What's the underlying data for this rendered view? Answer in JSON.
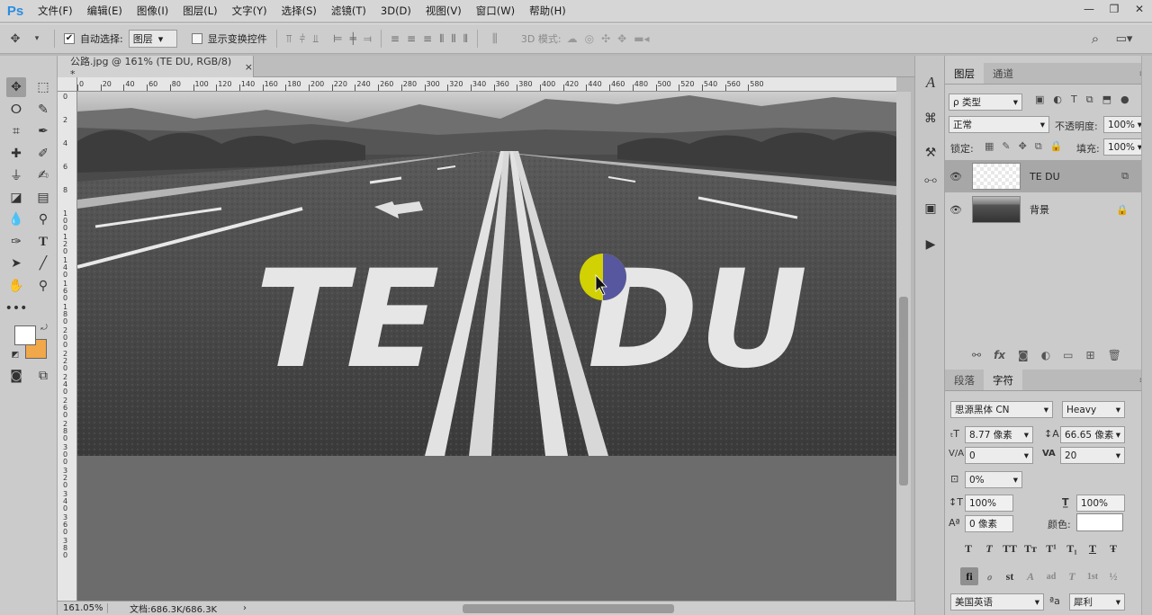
{
  "app": {
    "logo": "Ps"
  },
  "menubar": {
    "items": [
      "文件(F)",
      "编辑(E)",
      "图像(I)",
      "图层(L)",
      "文字(Y)",
      "选择(S)",
      "滤镜(T)",
      "3D(D)",
      "视图(V)",
      "窗口(W)",
      "帮助(H)"
    ]
  },
  "window_controls": {
    "minimize": "—",
    "restore": "❐",
    "close": "✕"
  },
  "options": {
    "auto_select_label": "自动选择:",
    "auto_select_checked": true,
    "auto_select_target": "图层",
    "show_transform_label": "显示变换控件",
    "show_transform_checked": false,
    "mode_3d_label": "3D 模式:"
  },
  "document": {
    "tab_title": "公路.jpg @ 161% (TE   DU, RGB/8) *",
    "tab_close": "×",
    "ruler_h": [
      "0",
      "20",
      "40",
      "60",
      "80",
      "100",
      "120",
      "140",
      "160",
      "180",
      "200",
      "220",
      "240",
      "260",
      "280",
      "300",
      "320",
      "340",
      "360",
      "380",
      "400",
      "420",
      "440",
      "460",
      "480",
      "500",
      "520",
      "540",
      "560",
      "580"
    ],
    "ruler_v": [
      "0",
      "2",
      "4",
      "6",
      "8",
      "1\n0\n0",
      "1\n2\n0",
      "1\n4\n0",
      "1\n6\n0",
      "1\n8\n0",
      "2\n0\n0",
      "2\n2\n0",
      "2\n4\n0",
      "2\n6\n0",
      "2\n8\n0",
      "3\n0\n0",
      "3\n2\n0",
      "3\n4\n0",
      "3\n6\n0",
      "3\n8\n0"
    ],
    "canvas_text_left": "TE",
    "canvas_text_right": "DU",
    "zoom": "161.05%",
    "doc_info": "文档:686.3K/686.3K",
    "status_arrow": "›"
  },
  "layers_panel": {
    "tabs": [
      "图层",
      "通道"
    ],
    "filter_label": "ρ 类型",
    "blend_mode": "正常",
    "opacity_label": "不透明度:",
    "opacity_value": "100%",
    "lock_label": "锁定:",
    "fill_label": "填充:",
    "fill_value": "100%",
    "layers": [
      {
        "name": "TE   DU",
        "visible": true,
        "selected": true
      },
      {
        "name": "背景",
        "visible": true,
        "selected": false
      }
    ]
  },
  "character_panel": {
    "tabs": [
      "段落",
      "字符"
    ],
    "font_family": "思源黑体 CN",
    "font_style": "Heavy",
    "font_size": "8.77 像素",
    "leading": "66.65 像素",
    "kerning": "0",
    "tracking": "20",
    "scale_pct": "0%",
    "vertical_scale": "100%",
    "horizontal_scale": "100%",
    "baseline_shift": "0 像素",
    "color_label": "颜色:",
    "text_color": "#ffffff",
    "style_buttons": [
      "T",
      "T",
      "TT",
      "Tт",
      "T¹",
      "T₁",
      "T",
      "Ŧ"
    ],
    "opentype_buttons": [
      "fi",
      "ℴ",
      "st",
      "A",
      "ad",
      "T",
      "1st",
      "½"
    ],
    "language": "美国英语",
    "aa_label": "ªa",
    "antialias": "犀利"
  },
  "colors": {
    "foreground": "#ffffff",
    "background": "#f0a84a",
    "accent": "#2a8de0"
  }
}
